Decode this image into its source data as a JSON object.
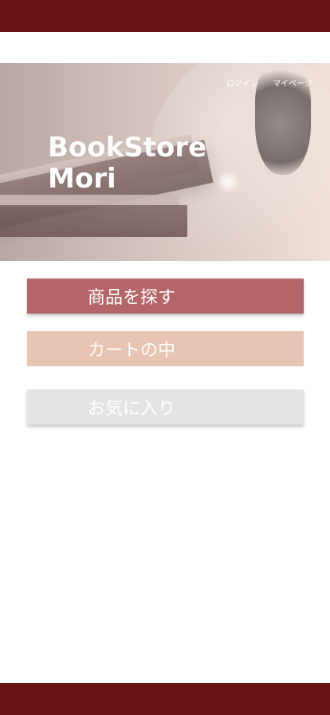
{
  "nav": {
    "login_label": "ログイン",
    "mypage_label": "マイページ"
  },
  "hero": {
    "title_line1": "BookStore",
    "title_line2": "Mori"
  },
  "menu": {
    "search_label": "商品を探す",
    "cart_label": "カートの中",
    "favorites_label": "お気に入り"
  },
  "colors": {
    "top_bar": "#6b1414",
    "bottom_bar": "#6b1414",
    "search_button": "#b5656a",
    "cart_button": "#e8c4b3",
    "favorites_button": "#e3e3e3",
    "text": "#ffffff"
  }
}
